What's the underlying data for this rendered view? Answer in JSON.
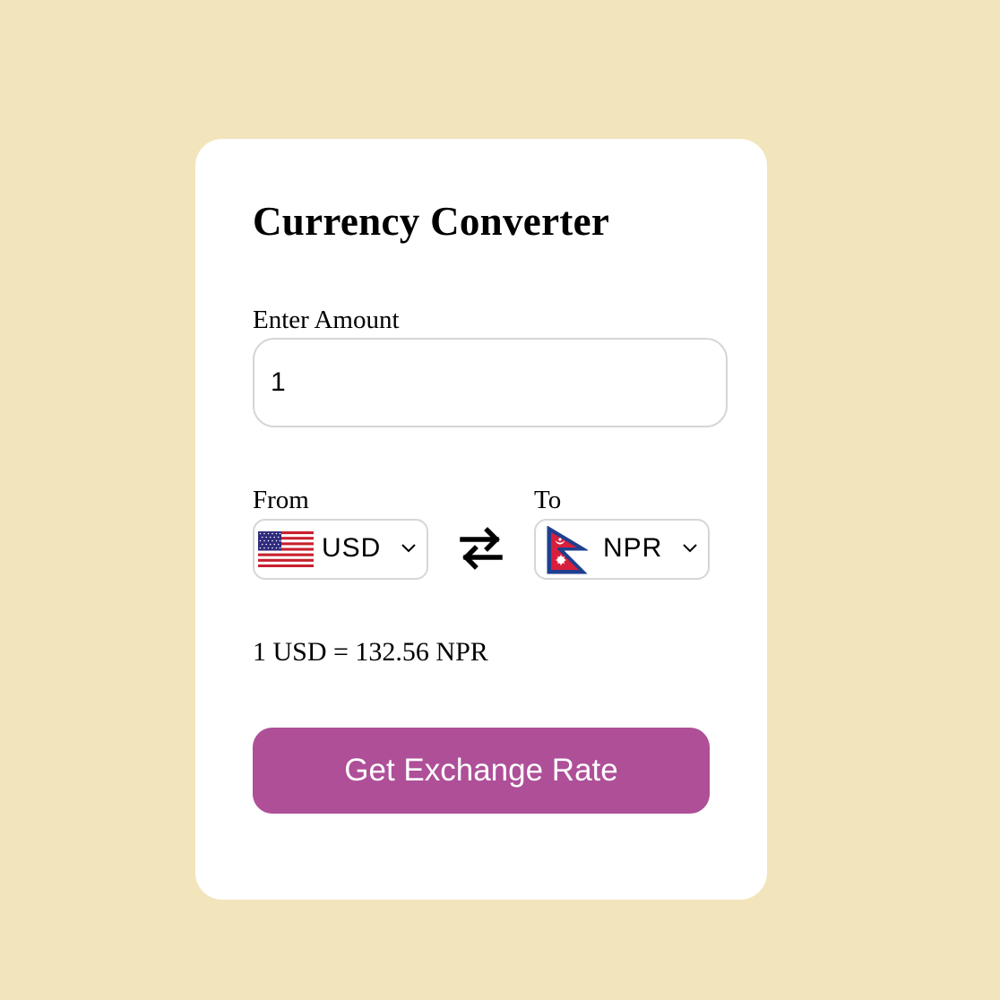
{
  "app": {
    "title": "Currency Converter"
  },
  "amount": {
    "label": "Enter Amount",
    "value": "1"
  },
  "from": {
    "label": "From",
    "code": "USD",
    "flag_icon": "us-flag-icon"
  },
  "to": {
    "label": "To",
    "code": "NPR",
    "flag_icon": "nepal-flag-icon"
  },
  "swap_icon": "swap-arrows-icon",
  "result_text": "1 USD = 132.56 NPR",
  "button_label": "Get Exchange Rate",
  "colors": {
    "background": "#f2e4bb",
    "card": "#ffffff",
    "button": "#ae4f98",
    "border": "#d6d6d6"
  }
}
